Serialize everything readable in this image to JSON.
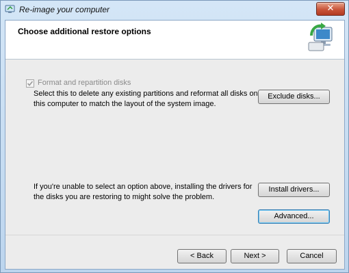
{
  "window": {
    "title": "Re-image your computer",
    "close_glyph": "✕"
  },
  "header": {
    "title": "Choose additional restore options",
    "icon": "computer-restore-icon"
  },
  "format_option": {
    "label": "Format and repartition disks",
    "checked": true,
    "disabled": true,
    "description": "Select this to delete any existing partitions and reformat all disks on this computer to match the layout of the system image.",
    "exclude_button": "Exclude disks..."
  },
  "drivers": {
    "description": "If you're unable to select an option above, installing the drivers for the disks you are restoring to might solve the problem.",
    "install_button": "Install drivers..."
  },
  "advanced_button": "Advanced...",
  "footer": {
    "back": "< Back",
    "next": "Next >",
    "cancel": "Cancel"
  },
  "colors": {
    "close_button": "#c9553a",
    "client_background": "#ececec",
    "header_background": "#ffffff"
  }
}
